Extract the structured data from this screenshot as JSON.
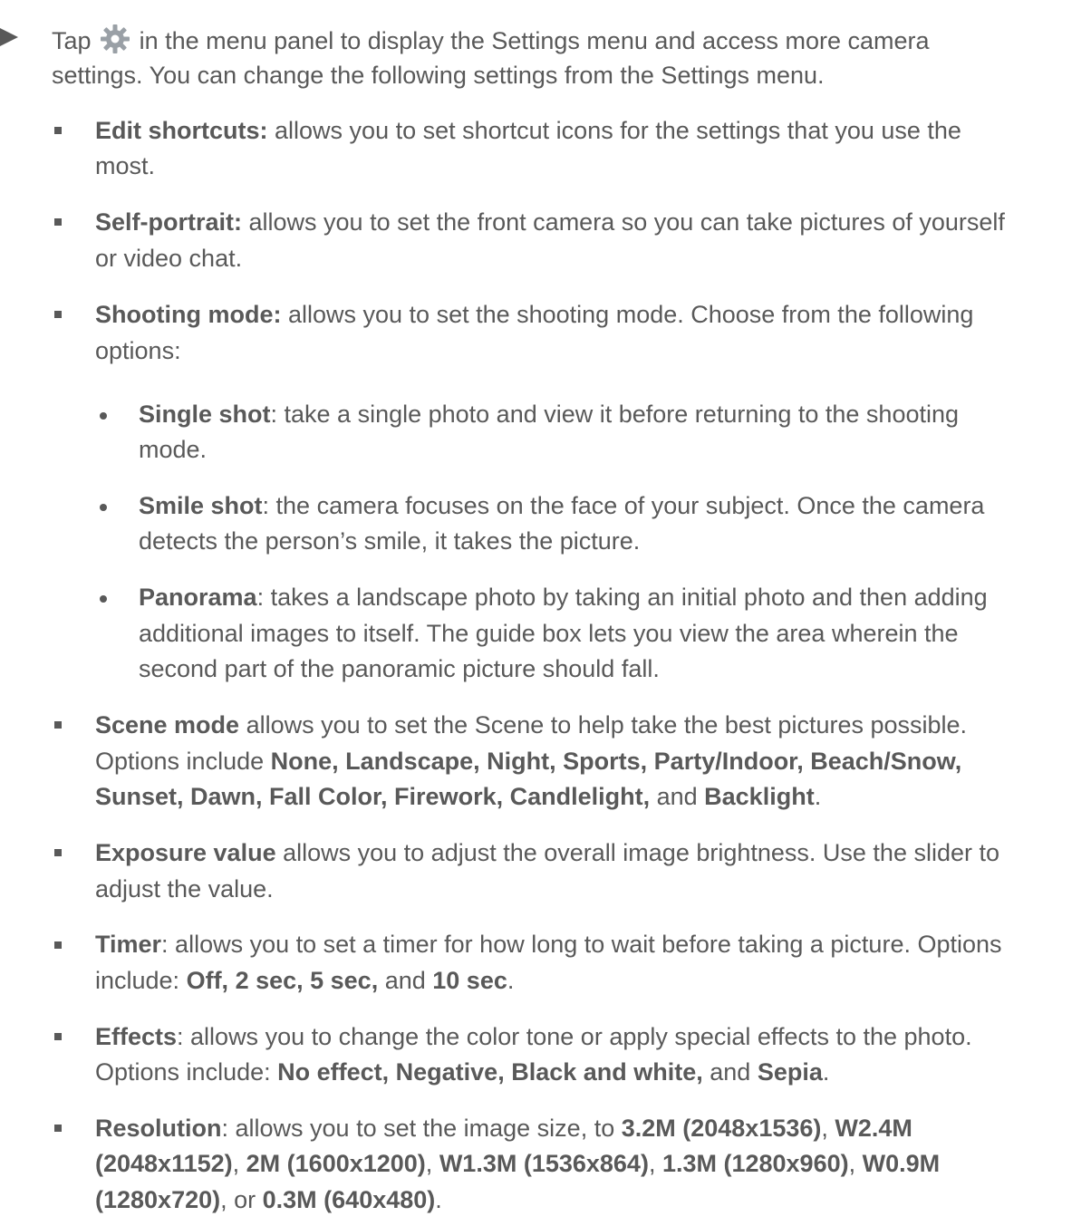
{
  "intro": {
    "line1_pre": "Tap",
    "icon": "gear-icon",
    "line1_post": "in the menu panel to display the Settings menu and access more camera",
    "line2": "settings. You can change the following settings from the Settings menu."
  },
  "items": {
    "edit_shortcuts": {
      "term": "Edit shortcuts:",
      "l1": "allows you to set shortcut icons for the settings that you use the",
      "l2": "most."
    },
    "self_portrait": {
      "term": "Self-portrait:",
      "l1": "allows you to set the front camera so you can take pictures of yourself",
      "l2": "or video chat."
    },
    "shooting_mode": {
      "term": "Shooting mode:",
      "l1": "allows you to set the shooting mode. Choose from the following",
      "l2": "options:",
      "sub": {
        "single": {
          "term": "Single shot",
          "l1": ": take a single photo and view it before returning to the shooting",
          "l2": "mode."
        },
        "smile": {
          "term": "Smile shot",
          "l1": ": the camera focuses on the face of your subject. Once the camera",
          "l2": "detects the person’s smile, it takes the picture."
        },
        "panorama": {
          "term": "Panorama",
          "l1": ": takes a landscape photo by taking an initial photo and then adding",
          "l2": "additional images to itself. The guide box lets you view the area wherein the",
          "l3": "second part of the panoramic picture should fall."
        }
      }
    },
    "scene_mode": {
      "term": "Scene mode",
      "l1": " allows you to set the Scene to help take the best pictures possible.",
      "l2_pre": "Options include ",
      "l2_bold": "None, Landscape, Night, Sports, Party/Indoor, Beach/Snow,",
      "l3_bold": "Sunset, Dawn, Fall Color, Firework, Candlelight,",
      "l3_and": " and ",
      "l3_bold2": "Backlight",
      "l3_end": "."
    },
    "exposure": {
      "term": "Exposure value",
      "l1": " allows you to adjust the overall image brightness. Use the slider to",
      "l2": "adjust the value."
    },
    "timer": {
      "term": "Timer",
      "l1": ": allows you to set a timer for how long to wait before taking a picture. Options",
      "l2_pre": "include: ",
      "l2_bold": "Off, 2 sec, 5 sec,",
      "l2_and": " and ",
      "l2_bold2": "10 sec",
      "l2_end": "."
    },
    "effects": {
      "term": "Effects",
      "l1": ": allows you to change the color tone or apply special effects to the photo.",
      "l2_pre": "Options include: ",
      "l2_bold": "No effect, Negative, Black and white,",
      "l2_and": " and ",
      "l2_bold2": "Sepia",
      "l2_end": "."
    },
    "resolution": {
      "term": "Resolution",
      "l1_mid": ": allows you to set the image size, to ",
      "r1": "3.2M (2048x1536)",
      "comma": ", ",
      "r2a": "W2.4M",
      "r2b": "(2048x1152)",
      "r3": "2M (1600x1200)",
      "r4": "W1.3M (1536x864)",
      "r5": "1.3M (1280x960)",
      "r6a": "W0.9M",
      "r6b": "(1280x720)",
      "or": ", or ",
      "r7": "0.3M (640x480)",
      "end": "."
    }
  }
}
